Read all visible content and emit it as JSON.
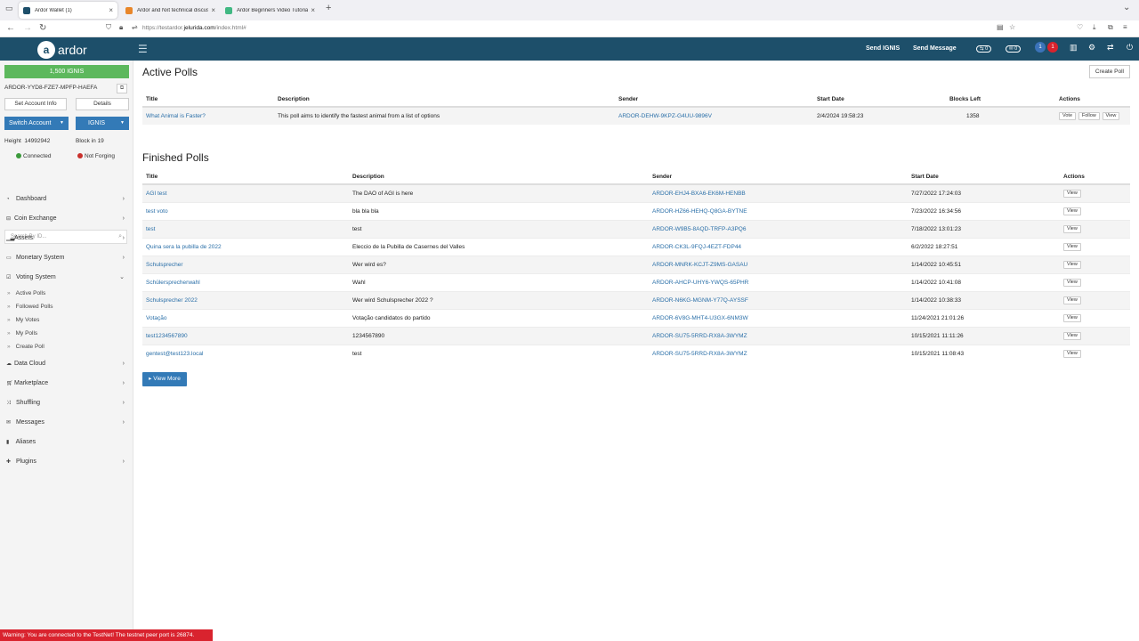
{
  "browser": {
    "tabs": [
      {
        "title": "Ardor Wallet (1)",
        "icon_color": "#1d4f6a"
      },
      {
        "title": "Ardor and Nxt technical discus",
        "icon_color": "#e8862a"
      },
      {
        "title": "Ardor Beginners Video Tutorials",
        "icon_color": "#41b883"
      }
    ],
    "url_prefix": "https://testardor.",
    "url_domain": "jelurida.com",
    "url_suffix": "/index.html#"
  },
  "header": {
    "logo_text": "ardor",
    "send_ignis": "Send IGNIS",
    "send_message": "Send Message",
    "badge1": "0",
    "badge2": "0",
    "notif_count": "1",
    "notif_count2": "1"
  },
  "sidebar": {
    "balance": "1,500  IGNIS",
    "account": "ARDOR-YYD8-FZE7-MPFP-HAEFA",
    "set_account_info": "Set Account Info",
    "details": "Details",
    "switch_account": "Switch Account",
    "chain": "IGNIS",
    "height_label": "Height",
    "height_value": "14992942",
    "block_in": "Block in 19",
    "connected": "Connected",
    "not_forging": "Not Forging",
    "search_placeholder": "Search By ID...",
    "menu": [
      {
        "label": "Dashboard",
        "icon": "dashboard-icon"
      },
      {
        "label": "Coin Exchange",
        "icon": "exchange-icon"
      },
      {
        "label": "Assets",
        "icon": "chart-icon"
      },
      {
        "label": "Monetary System",
        "icon": "bank-icon"
      },
      {
        "label": "Voting System",
        "icon": "checkbox-icon"
      },
      {
        "label": "Data Cloud",
        "icon": "cloud-icon"
      },
      {
        "label": "Marketplace",
        "icon": "cart-icon"
      },
      {
        "label": "Shuffling",
        "icon": "shuffle-icon"
      },
      {
        "label": "Messages",
        "icon": "envelope-icon"
      },
      {
        "label": "Aliases",
        "icon": "bookmark-icon"
      },
      {
        "label": "Plugins",
        "icon": "puzzle-icon"
      }
    ],
    "voting_sub": [
      "Active Polls",
      "Followed Polls",
      "My Votes",
      "My Polls",
      "Create Poll"
    ]
  },
  "active_polls": {
    "heading": "Active Polls",
    "create_poll": "Create Poll",
    "columns": [
      "Title",
      "Description",
      "Sender",
      "Start Date",
      "Blocks Left",
      "Actions"
    ],
    "rows": [
      {
        "title": "What Animal is Faster?",
        "description": "This poll aims to identify the fastest animal from a list of options",
        "sender": "ARDOR-DEHW-9KPZ-G4UU-9896V",
        "start": "2/4/2024 19:58:23",
        "blocks": "1358"
      }
    ],
    "actions": [
      "Vote",
      "Follow",
      "View"
    ]
  },
  "finished_polls": {
    "heading": "Finished Polls",
    "columns": [
      "Title",
      "Description",
      "Sender",
      "Start Date",
      "Actions"
    ],
    "view_label": "View",
    "rows": [
      {
        "title": "AGI test",
        "description": "The DAO of AGI is here",
        "sender": "ARDOR-EHJ4-BXA6-EK6M-HENBB",
        "start": "7/27/2022 17:24:03"
      },
      {
        "title": "test voto",
        "description": "bla bla bla",
        "sender": "ARDOR-HZ66-HEHQ-Q8GA-BYTNE",
        "start": "7/23/2022 16:34:56"
      },
      {
        "title": "test",
        "description": "test",
        "sender": "ARDOR-W9B5-8AQD-TRFP-A3PQ6",
        "start": "7/18/2022 13:01:23"
      },
      {
        "title": "Quina sera la pubilla de 2022",
        "description": "Eleccio de la Pubilla de Casernes del Valles",
        "sender": "ARDOR-CK3L-9FQJ-4EZT-FDP44",
        "start": "6/2/2022 18:27:51"
      },
      {
        "title": "Schulsprecher",
        "description": "Wer wird es?",
        "sender": "ARDOR-MNRK-KCJT-Z9MS-GASAU",
        "start": "1/14/2022 10:45:51"
      },
      {
        "title": "Schülersprecherwahl",
        "description": "Wahl",
        "sender": "ARDOR-AHCP-UHY6-YWQS-65PHR",
        "start": "1/14/2022 10:41:08"
      },
      {
        "title": "Schulsprecher 2022",
        "description": "Wer wird Schulsprecher 2022 ?",
        "sender": "ARDOR-N6KG-MGNM-Y77Q-AYSSF",
        "start": "1/14/2022 10:38:33"
      },
      {
        "title": "Votação",
        "description": "Votação candidatos do partido",
        "sender": "ARDOR-6V8G-MHT4-U3GX-6NM3W",
        "start": "11/24/2021 21:01:26"
      },
      {
        "title": "test1234567890",
        "description": "1234567890",
        "sender": "ARDOR-SU75-5RRD-RX8A-3WYMZ",
        "start": "10/15/2021 11:11:26"
      },
      {
        "title": "gentest@test123.local",
        "description": "test",
        "sender": "ARDOR-SU75-5RRD-RX8A-3WYMZ",
        "start": "10/15/2021 11:08:43"
      }
    ],
    "view_more": "▸ View More"
  },
  "warning": "Warning: You are connected to the TestNet! The testnet peer port is 26874."
}
